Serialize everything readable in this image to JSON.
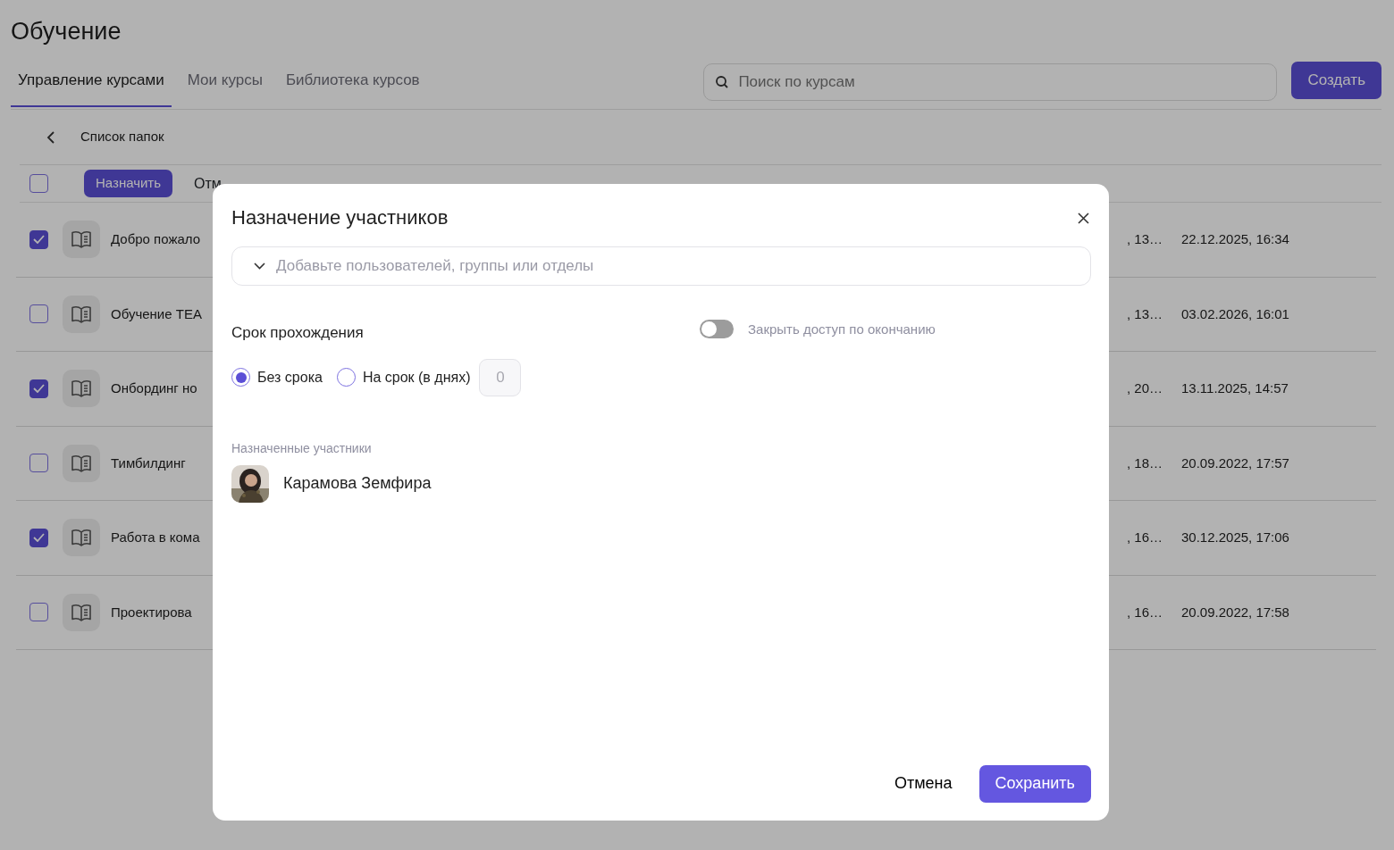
{
  "page": {
    "title": "Обучение"
  },
  "tabs": [
    {
      "label": "Управление курсами",
      "selected": true
    },
    {
      "label": "Мои курсы",
      "selected": false
    },
    {
      "label": "Библиотека курсов",
      "selected": false
    }
  ],
  "search": {
    "placeholder": "Поиск по курсам"
  },
  "create_button": "Создать",
  "folder_title": "Список папок",
  "bulk_bar": {
    "checked": false,
    "assign_button": "Назначить",
    "cancel_button": "Отм"
  },
  "rows": [
    {
      "checked": true,
      "title": "Добро пожало",
      "column_2": ", 13…",
      "date": "22.12.2025, 16:34"
    },
    {
      "checked": false,
      "title": "Обучение TEA",
      "column_2": ", 13…",
      "date": "03.02.2026, 16:01"
    },
    {
      "checked": true,
      "title": "Онбординг но",
      "column_2": ", 20…",
      "date": "13.11.2025, 14:57"
    },
    {
      "checked": false,
      "title": "Тимбилдинг",
      "column_2": ", 18…",
      "date": "20.09.2022, 17:57"
    },
    {
      "checked": true,
      "title": "Работа в кома",
      "column_2": ", 16…",
      "date": "30.12.2025, 17:06"
    },
    {
      "checked": false,
      "title": "Проектирова",
      "column_2": ", 16…",
      "date": "20.09.2022, 17:58"
    }
  ],
  "modal": {
    "title": "Назначение участников",
    "picker_placeholder": "Добавьте пользователей, группы или отделы",
    "deadline_label": "Срок прохождения",
    "close_access": {
      "label": "Закрыть доступ по окончанию",
      "on": false
    },
    "deadline_options": [
      {
        "label": "Без срока",
        "selected": true
      },
      {
        "label": "На срок (в днях)",
        "selected": false
      }
    ],
    "days_field": {
      "value": "0",
      "disabled": true
    },
    "assigned_label": "Назначенные участники",
    "participants": [
      {
        "name": "Карамова Земфира"
      }
    ],
    "cancel_button": "Отмена",
    "save_button": "Сохранить"
  }
}
